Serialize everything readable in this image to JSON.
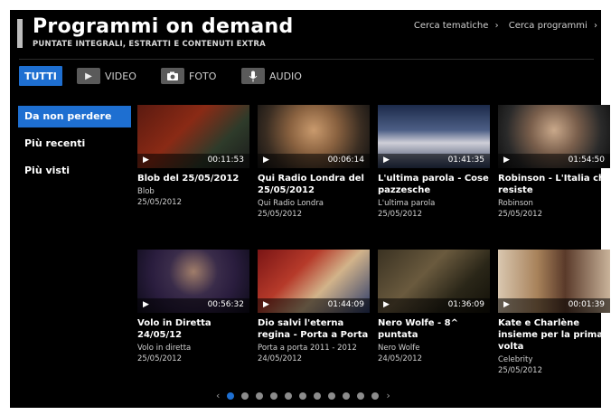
{
  "header": {
    "title": "Programmi on demand",
    "subtitle": "PUNTATE INTEGRALI, ESTRATTI E CONTENUTI EXTRA",
    "link_themes": "Cerca tematiche",
    "link_programs": "Cerca programmi"
  },
  "filters": [
    {
      "label": "TUTTI",
      "icon": ""
    },
    {
      "label": "VIDEO",
      "icon": "play-icon"
    },
    {
      "label": "FOTO",
      "icon": "camera-icon"
    },
    {
      "label": "AUDIO",
      "icon": "microphone-icon"
    }
  ],
  "sidebar": {
    "items": [
      {
        "label": "Da non perdere"
      },
      {
        "label": "Più recenti"
      },
      {
        "label": "Più visti"
      }
    ]
  },
  "cards": [
    {
      "title": "Blob del 25/05/2012",
      "subtitle": "Blob",
      "date": "25/05/2012",
      "duration": "00:11:53"
    },
    {
      "title": "Qui Radio Londra del 25/05/2012",
      "subtitle": "Qui Radio Londra",
      "date": "25/05/2012",
      "duration": "00:06:14"
    },
    {
      "title": "L'ultima parola - Cose pazzesche",
      "subtitle": "L'ultima parola",
      "date": "25/05/2012",
      "duration": "01:41:35"
    },
    {
      "title": "Robinson - L'Italia che resiste",
      "subtitle": "Robinson",
      "date": "25/05/2012",
      "duration": "01:54:50"
    },
    {
      "title": "Volo in Diretta 24/05/12",
      "subtitle": "Volo in diretta",
      "date": "25/05/2012",
      "duration": "00:56:32"
    },
    {
      "title": "Dio salvi l'eterna regina - Porta a Porta",
      "subtitle": "Porta a porta 2011 - 2012",
      "date": "24/05/2012",
      "duration": "01:44:09"
    },
    {
      "title": "Nero Wolfe - 8^ puntata",
      "subtitle": "Nero Wolfe",
      "date": "24/05/2012",
      "duration": "01:36:09"
    },
    {
      "title": "Kate e Charlène insieme per la prima volta",
      "subtitle": "Celebrity",
      "date": "25/05/2012",
      "duration": "00:01:39"
    }
  ],
  "pager": {
    "prev": "‹",
    "next": "›",
    "pages": 11,
    "active_page": 1
  }
}
